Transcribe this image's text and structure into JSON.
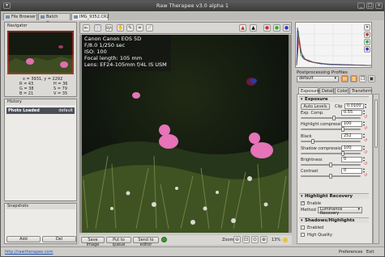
{
  "window": {
    "title": "Raw Therapee v3.0 alpha 1"
  },
  "tabs": [
    {
      "label": "File Browser"
    },
    {
      "label": "Batch Queue"
    },
    {
      "label": "IMG_9352.CR2"
    }
  ],
  "navigator": {
    "title": "Navigator",
    "coords": "x = 3931, y = 2292",
    "readout": [
      [
        "R = 43",
        "H = 36"
      ],
      [
        "G = 38",
        "S = 79"
      ],
      [
        "B = 21",
        "V = 35"
      ]
    ]
  },
  "history": {
    "title": "History",
    "item": "Photo Loaded",
    "item_value": "default"
  },
  "snapshots": {
    "title": "Snapshots",
    "add": "Add",
    "del": "Del"
  },
  "overlay": {
    "lines": [
      "Canon Canon EOS 5D",
      "F/8.0  1/250 sec",
      "ISO: 100",
      "Focal length: 105 mm",
      "Lens: EF24-105mm f/4L IS USM"
    ]
  },
  "bottom": {
    "save_image": "Save Image",
    "put_queue": "Put to queue",
    "send_editor": "Send to editor",
    "zoom_label": "Zoom",
    "zoom_value": "13%"
  },
  "profiles": {
    "title": "Postprocessing Profiles",
    "selected": "default"
  },
  "right_tabs": [
    {
      "label": "Exposure"
    },
    {
      "label": "Detail"
    },
    {
      "label": "Color"
    },
    {
      "label": "Transform"
    }
  ],
  "exposure": {
    "title": "Exposure",
    "auto_levels": "Auto Levels",
    "clip_label": "Clip",
    "clip_value": "0.0100",
    "rows": [
      {
        "label": "Exp. Comp.",
        "value": "0.55",
        "pos": 0.55
      },
      {
        "label": "Highlight compression",
        "value": "100",
        "pos": 0.72
      },
      {
        "label": "Black",
        "value": "252",
        "pos": 0.18
      },
      {
        "label": "Shadow compression",
        "value": "100",
        "pos": 0.72
      },
      {
        "label": "Brightness",
        "value": "0",
        "pos": 0.5
      },
      {
        "label": "Contrast",
        "value": "0",
        "pos": 0.5
      }
    ]
  },
  "highlight_recovery": {
    "title": "Highlight Recovery",
    "enable": "Enable",
    "method_label": "Method",
    "method_value": "Luminance Recovery"
  },
  "shadows_highlights": {
    "title": "Shadows/Highlights",
    "enabled": "Enabled",
    "high_quality": "High Quality"
  },
  "status": {
    "url": "http://rawtherapee.com",
    "preferences": "Preferences",
    "exit": "Exit"
  },
  "colors": {
    "accent": "#d9892e",
    "titlebar": "#3a3a3a",
    "image_bg": "#0d1108"
  }
}
